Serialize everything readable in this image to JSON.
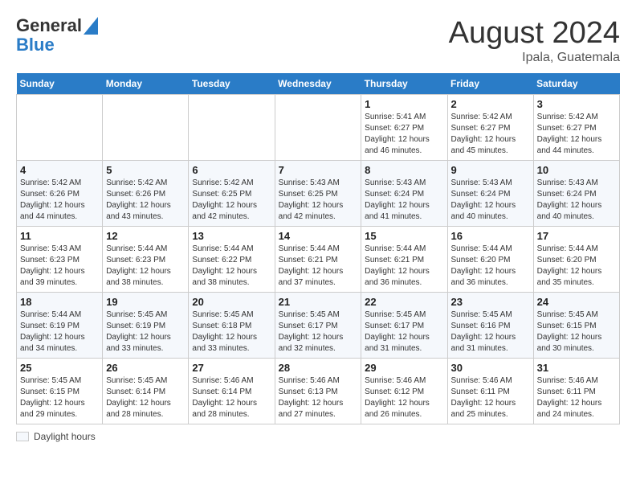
{
  "header": {
    "logo_line1": "General",
    "logo_line2": "Blue",
    "month_year": "August 2024",
    "location": "Ipala, Guatemala"
  },
  "days_of_week": [
    "Sunday",
    "Monday",
    "Tuesday",
    "Wednesday",
    "Thursday",
    "Friday",
    "Saturday"
  ],
  "weeks": [
    [
      {
        "day": "",
        "info": ""
      },
      {
        "day": "",
        "info": ""
      },
      {
        "day": "",
        "info": ""
      },
      {
        "day": "",
        "info": ""
      },
      {
        "day": "1",
        "info": "Sunrise: 5:41 AM\nSunset: 6:27 PM\nDaylight: 12 hours\nand 46 minutes."
      },
      {
        "day": "2",
        "info": "Sunrise: 5:42 AM\nSunset: 6:27 PM\nDaylight: 12 hours\nand 45 minutes."
      },
      {
        "day": "3",
        "info": "Sunrise: 5:42 AM\nSunset: 6:27 PM\nDaylight: 12 hours\nand 44 minutes."
      }
    ],
    [
      {
        "day": "4",
        "info": "Sunrise: 5:42 AM\nSunset: 6:26 PM\nDaylight: 12 hours\nand 44 minutes."
      },
      {
        "day": "5",
        "info": "Sunrise: 5:42 AM\nSunset: 6:26 PM\nDaylight: 12 hours\nand 43 minutes."
      },
      {
        "day": "6",
        "info": "Sunrise: 5:42 AM\nSunset: 6:25 PM\nDaylight: 12 hours\nand 42 minutes."
      },
      {
        "day": "7",
        "info": "Sunrise: 5:43 AM\nSunset: 6:25 PM\nDaylight: 12 hours\nand 42 minutes."
      },
      {
        "day": "8",
        "info": "Sunrise: 5:43 AM\nSunset: 6:24 PM\nDaylight: 12 hours\nand 41 minutes."
      },
      {
        "day": "9",
        "info": "Sunrise: 5:43 AM\nSunset: 6:24 PM\nDaylight: 12 hours\nand 40 minutes."
      },
      {
        "day": "10",
        "info": "Sunrise: 5:43 AM\nSunset: 6:24 PM\nDaylight: 12 hours\nand 40 minutes."
      }
    ],
    [
      {
        "day": "11",
        "info": "Sunrise: 5:43 AM\nSunset: 6:23 PM\nDaylight: 12 hours\nand 39 minutes."
      },
      {
        "day": "12",
        "info": "Sunrise: 5:44 AM\nSunset: 6:23 PM\nDaylight: 12 hours\nand 38 minutes."
      },
      {
        "day": "13",
        "info": "Sunrise: 5:44 AM\nSunset: 6:22 PM\nDaylight: 12 hours\nand 38 minutes."
      },
      {
        "day": "14",
        "info": "Sunrise: 5:44 AM\nSunset: 6:21 PM\nDaylight: 12 hours\nand 37 minutes."
      },
      {
        "day": "15",
        "info": "Sunrise: 5:44 AM\nSunset: 6:21 PM\nDaylight: 12 hours\nand 36 minutes."
      },
      {
        "day": "16",
        "info": "Sunrise: 5:44 AM\nSunset: 6:20 PM\nDaylight: 12 hours\nand 36 minutes."
      },
      {
        "day": "17",
        "info": "Sunrise: 5:44 AM\nSunset: 6:20 PM\nDaylight: 12 hours\nand 35 minutes."
      }
    ],
    [
      {
        "day": "18",
        "info": "Sunrise: 5:44 AM\nSunset: 6:19 PM\nDaylight: 12 hours\nand 34 minutes."
      },
      {
        "day": "19",
        "info": "Sunrise: 5:45 AM\nSunset: 6:19 PM\nDaylight: 12 hours\nand 33 minutes."
      },
      {
        "day": "20",
        "info": "Sunrise: 5:45 AM\nSunset: 6:18 PM\nDaylight: 12 hours\nand 33 minutes."
      },
      {
        "day": "21",
        "info": "Sunrise: 5:45 AM\nSunset: 6:17 PM\nDaylight: 12 hours\nand 32 minutes."
      },
      {
        "day": "22",
        "info": "Sunrise: 5:45 AM\nSunset: 6:17 PM\nDaylight: 12 hours\nand 31 minutes."
      },
      {
        "day": "23",
        "info": "Sunrise: 5:45 AM\nSunset: 6:16 PM\nDaylight: 12 hours\nand 31 minutes."
      },
      {
        "day": "24",
        "info": "Sunrise: 5:45 AM\nSunset: 6:15 PM\nDaylight: 12 hours\nand 30 minutes."
      }
    ],
    [
      {
        "day": "25",
        "info": "Sunrise: 5:45 AM\nSunset: 6:15 PM\nDaylight: 12 hours\nand 29 minutes."
      },
      {
        "day": "26",
        "info": "Sunrise: 5:45 AM\nSunset: 6:14 PM\nDaylight: 12 hours\nand 28 minutes."
      },
      {
        "day": "27",
        "info": "Sunrise: 5:46 AM\nSunset: 6:14 PM\nDaylight: 12 hours\nand 28 minutes."
      },
      {
        "day": "28",
        "info": "Sunrise: 5:46 AM\nSunset: 6:13 PM\nDaylight: 12 hours\nand 27 minutes."
      },
      {
        "day": "29",
        "info": "Sunrise: 5:46 AM\nSunset: 6:12 PM\nDaylight: 12 hours\nand 26 minutes."
      },
      {
        "day": "30",
        "info": "Sunrise: 5:46 AM\nSunset: 6:11 PM\nDaylight: 12 hours\nand 25 minutes."
      },
      {
        "day": "31",
        "info": "Sunrise: 5:46 AM\nSunset: 6:11 PM\nDaylight: 12 hours\nand 24 minutes."
      }
    ]
  ],
  "legend": {
    "label": "Daylight hours"
  }
}
